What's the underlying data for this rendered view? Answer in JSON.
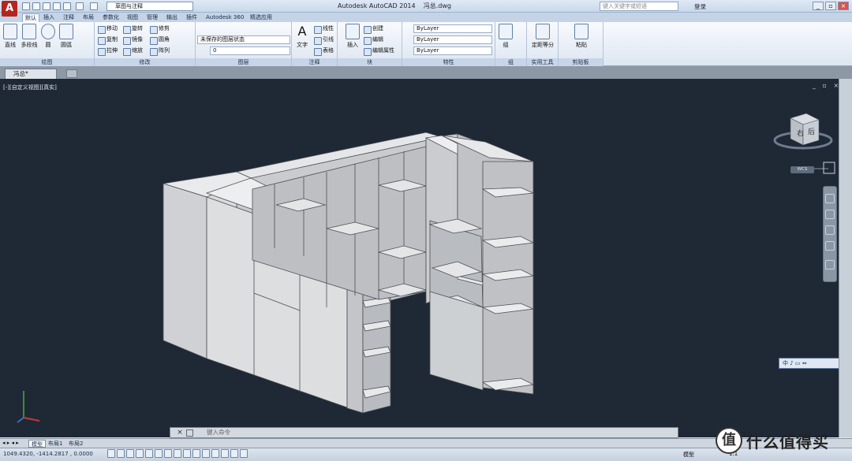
{
  "app": {
    "title": "Autodesk AutoCAD 2014",
    "file": "冯总.dwg",
    "logo": "A",
    "workspace": "草图与注释"
  },
  "search": {
    "placeholder": "键入关键字或短语"
  },
  "login": {
    "label": "登录"
  },
  "ribbon_tabs": [
    "默认",
    "插入",
    "注释",
    "布局",
    "参数化",
    "视图",
    "管理",
    "输出",
    "插件",
    "Autodesk 360",
    "精选应用"
  ],
  "panels": {
    "draw": {
      "label": "绘图",
      "line": "直线",
      "polyline": "多段线",
      "circle": "圆",
      "arc": "圆弧"
    },
    "modify": {
      "label": "修改",
      "move": "移动",
      "rotate": "旋转",
      "trim": "修剪",
      "copy": "复制",
      "mirror": "镜像",
      "fillet": "圆角",
      "stretch": "拉伸",
      "scale": "缩放",
      "array": "阵列"
    },
    "layers": {
      "label": "图层",
      "state": "未保存的图层状态",
      "current": "0"
    },
    "annotation": {
      "label": "注释",
      "text": "文字",
      "linear": "线性",
      "leader": "引线",
      "table": "表格"
    },
    "block": {
      "label": "块",
      "insert": "插入",
      "create": "创建",
      "edit": "编辑",
      "edit_attrs": "编辑属性"
    },
    "properties": {
      "label": "特性",
      "color": "ByLayer",
      "linetype": "ByLayer",
      "lineweight": "ByLayer"
    },
    "groups": {
      "label": "组",
      "group": "组"
    },
    "utilities": {
      "label": "实用工具",
      "measure": "定距等分"
    },
    "clipboard": {
      "label": "剪贴板",
      "paste": "粘贴"
    }
  },
  "doc_tab": {
    "label": "冯总*"
  },
  "viewport": {
    "label": "[-][自定义视图][真实]",
    "controls": "_ ▫ ×",
    "viewcube_top": "右",
    "viewcube_front": "后",
    "wcs": "WCS"
  },
  "command": {
    "placeholder": "键入命令"
  },
  "layout_tabs": [
    "模型",
    "布局1",
    "布局2"
  ],
  "status": {
    "coords": "1049.4320,  -1414.2817  , 0.0000",
    "model": "模型",
    "scale": "1:1"
  },
  "floatbar": {
    "label": "中 ♪ ▭ ⇔"
  },
  "watermark": {
    "text": "什么值得买",
    "mark": "值"
  }
}
